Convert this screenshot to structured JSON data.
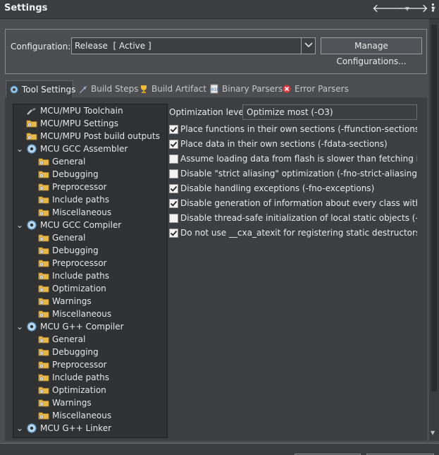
{
  "window": {
    "title": "Settings"
  },
  "configuration": {
    "label": "Configuration:",
    "selected": "Release  [ Active ]",
    "manage_label": "Manage Configurations..."
  },
  "tabs": [
    {
      "label": "Tool Settings",
      "icon": "tool-settings-icon",
      "active": true
    },
    {
      "label": "Build Steps",
      "icon": "build-steps-icon",
      "active": false
    },
    {
      "label": "Build Artifact",
      "icon": "trophy-icon",
      "active": false
    },
    {
      "label": "Binary Parsers",
      "icon": "binary-parser-icon",
      "active": false
    },
    {
      "label": "Error Parsers",
      "icon": "error-parser-icon",
      "active": false
    }
  ],
  "tree": [
    {
      "label": "MCU/MPU Toolchain",
      "icon": "toolchain-icon",
      "level": 0,
      "expanded": null
    },
    {
      "label": "MCU/MPU Settings",
      "icon": "folder-settings-icon",
      "level": 0,
      "expanded": null
    },
    {
      "label": "MCU/MPU Post build outputs",
      "icon": "folder-settings-icon",
      "level": 0,
      "expanded": null
    },
    {
      "label": "MCU GCC Assembler",
      "icon": "gear-tool-icon",
      "level": 0,
      "expanded": true
    },
    {
      "label": "General",
      "icon": "folder-settings-icon",
      "level": 1
    },
    {
      "label": "Debugging",
      "icon": "folder-settings-icon",
      "level": 1
    },
    {
      "label": "Preprocessor",
      "icon": "folder-settings-icon",
      "level": 1
    },
    {
      "label": "Include paths",
      "icon": "folder-settings-icon",
      "level": 1
    },
    {
      "label": "Miscellaneous",
      "icon": "folder-settings-icon",
      "level": 1
    },
    {
      "label": "MCU GCC Compiler",
      "icon": "gear-tool-icon",
      "level": 0,
      "expanded": true
    },
    {
      "label": "General",
      "icon": "folder-settings-icon",
      "level": 1
    },
    {
      "label": "Debugging",
      "icon": "folder-settings-icon",
      "level": 1
    },
    {
      "label": "Preprocessor",
      "icon": "folder-settings-icon",
      "level": 1
    },
    {
      "label": "Include paths",
      "icon": "folder-settings-icon",
      "level": 1
    },
    {
      "label": "Optimization",
      "icon": "folder-settings-icon",
      "level": 1
    },
    {
      "label": "Warnings",
      "icon": "folder-settings-icon",
      "level": 1
    },
    {
      "label": "Miscellaneous",
      "icon": "folder-settings-icon",
      "level": 1
    },
    {
      "label": "MCU G++ Compiler",
      "icon": "gear-tool-icon",
      "level": 0,
      "expanded": true
    },
    {
      "label": "General",
      "icon": "folder-settings-icon",
      "level": 1
    },
    {
      "label": "Debugging",
      "icon": "folder-settings-icon",
      "level": 1
    },
    {
      "label": "Preprocessor",
      "icon": "folder-settings-icon",
      "level": 1
    },
    {
      "label": "Include paths",
      "icon": "folder-settings-icon",
      "level": 1
    },
    {
      "label": "Optimization",
      "icon": "folder-settings-icon",
      "level": 1
    },
    {
      "label": "Warnings",
      "icon": "folder-settings-icon",
      "level": 1
    },
    {
      "label": "Miscellaneous",
      "icon": "folder-settings-icon",
      "level": 1
    },
    {
      "label": "MCU G++ Linker",
      "icon": "gear-tool-icon",
      "level": 0,
      "expanded": true
    }
  ],
  "options": {
    "optimization_level_label": "Optimization level",
    "optimization_level_value": "Optimize most (-O3)",
    "checkboxes": [
      {
        "label": "Place functions in their own sections (-ffunction-sections)",
        "checked": true
      },
      {
        "label": "Place data in their own sections (-fdata-sections)",
        "checked": true
      },
      {
        "label": "Assume loading data from flash is slower than fetching instruct",
        "checked": false
      },
      {
        "label": "Disable \"strict aliasing\" optimization (-fno-strict-aliasing)",
        "checked": false
      },
      {
        "label": "Disable handling exceptions (-fno-exceptions)",
        "checked": true
      },
      {
        "label": "Disable generation of information about every class with virtual",
        "checked": true
      },
      {
        "label": "Disable thread-safe initialization of local static objects (-fno-thre",
        "checked": false
      },
      {
        "label": "Do not use __cxa_atexit for registering static destructors (-fno-c",
        "checked": true
      }
    ]
  },
  "colors": {
    "background": "#4b4d50",
    "panel": "#3c3f41",
    "tree_bg": "#2f3133",
    "folder": "#e6b84a"
  }
}
